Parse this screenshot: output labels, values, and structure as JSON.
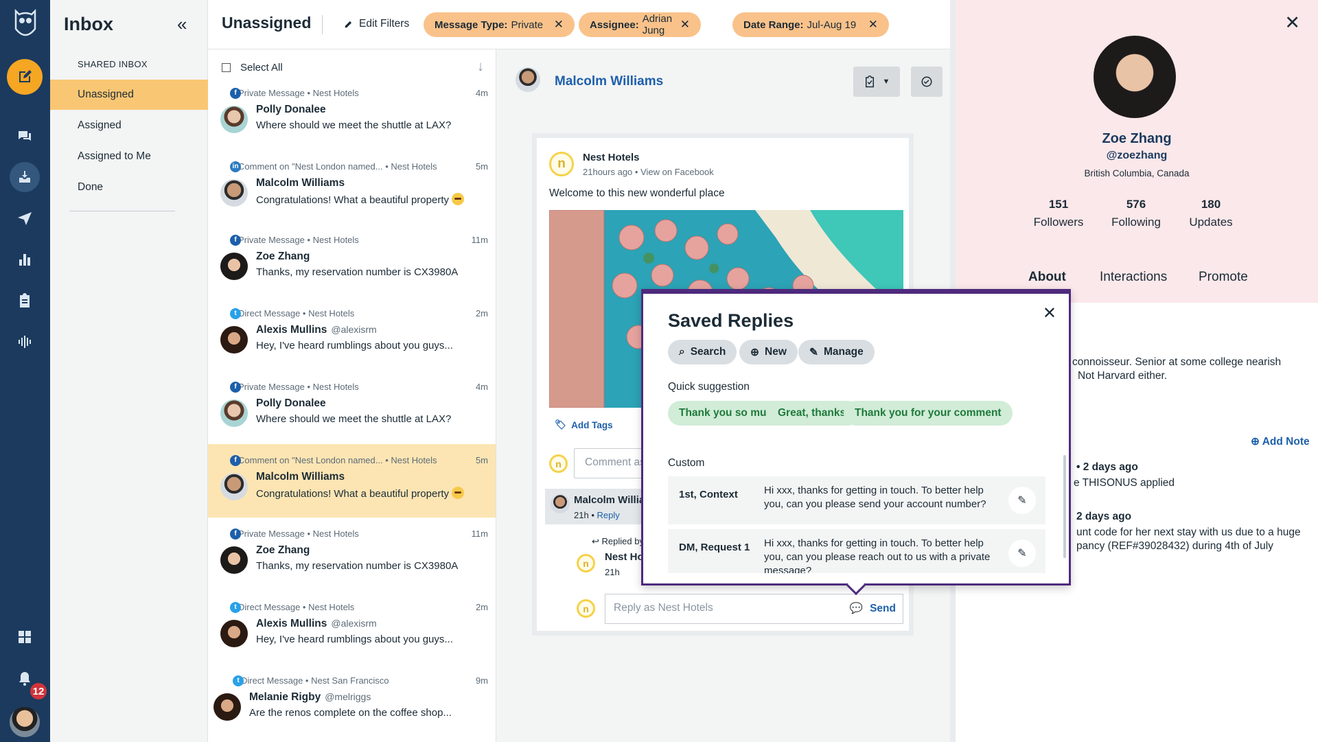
{
  "rail": {
    "notification_count": "12"
  },
  "nav": {
    "title": "Inbox",
    "section": "SHARED INBOX",
    "items": [
      "Unassigned",
      "Assigned",
      "Assigned to Me",
      "Done"
    ]
  },
  "topbar": {
    "title": "Unassigned",
    "edit_filters": "Edit Filters",
    "chips": [
      {
        "key": "Message Type:",
        "value": "Private"
      },
      {
        "key": "Assignee:",
        "value": "Adrian Jung"
      },
      {
        "key": "Date Range:",
        "value": "Jul-Aug 19"
      }
    ]
  },
  "list": {
    "select_all": "Select All",
    "messages": [
      {
        "network": "f",
        "type": "Private Message",
        "account": "Nest Hotels",
        "time": "4m",
        "name": "Polly Donalee",
        "handle": "",
        "text": "Where should we meet the shuttle at LAX?"
      },
      {
        "network": "in",
        "type": "Comment on \"Nest London named...",
        "account": "Nest Hotels",
        "time": "5m",
        "name": "Malcolm Williams",
        "handle": "",
        "text": "Congratulations! What a beautiful property"
      },
      {
        "network": "f",
        "type": "Private Message",
        "account": "Nest Hotels",
        "time": "11m",
        "name": "Zoe Zhang",
        "handle": "",
        "text": "Thanks, my reservation number is CX3980A"
      },
      {
        "network": "t",
        "type": "Direct Message",
        "account": "Nest Hotels",
        "time": "2m",
        "name": "Alexis Mullins",
        "handle": "@alexisrm",
        "text": "Hey, I've heard rumblings about you guys..."
      },
      {
        "network": "f",
        "type": "Private Message",
        "account": "Nest Hotels",
        "time": "4m",
        "name": "Polly Donalee",
        "handle": "",
        "text": "Where should we meet the shuttle at LAX?"
      },
      {
        "network": "f",
        "type": "Comment on \"Nest London named...",
        "account": "Nest Hotels",
        "time": "5m",
        "name": "Malcolm Williams",
        "handle": "",
        "text": "Congratulations! What a beautiful property"
      },
      {
        "network": "f",
        "type": "Private Message",
        "account": "Nest Hotels",
        "time": "11m",
        "name": "Zoe Zhang",
        "handle": "",
        "text": "Thanks, my reservation number is CX3980A"
      },
      {
        "network": "t",
        "type": "Direct Message",
        "account": "Nest Hotels",
        "time": "2m",
        "name": "Alexis Mullins",
        "handle": "@alexisrm",
        "text": "Hey, I've heard rumblings about you guys..."
      },
      {
        "network": "t",
        "type": "Direct Message",
        "account": "Nest San Francisco",
        "time": "9m",
        "name": "Melanie Rigby",
        "handle": "@melriggs",
        "text": "Are the renos complete on the coffee shop..."
      }
    ]
  },
  "conversation": {
    "contact": "Malcolm Williams",
    "post": {
      "brand_initial": "n",
      "account": "Nest Hotels",
      "age": "21hours ago",
      "view_on": "View on Facebook",
      "text": "Welcome to this new wonderful place"
    },
    "add_tags": "Add Tags",
    "comment_placeholder": "Comment as Nest Hotels",
    "reply_author": "Malcolm Williams",
    "reply_age": "21h",
    "reply_link": "Reply",
    "replied_by": "Replied by",
    "reply_account": "Nest Hotels",
    "reply_account_age": "21h",
    "reply_placeholder": "Reply as Nest Hotels",
    "send": "Send"
  },
  "profile": {
    "name": "Zoe Zhang",
    "handle": "@zoezhang",
    "location": "British Columbia, Canada",
    "stats": [
      {
        "value": "151",
        "label": "Followers"
      },
      {
        "value": "576",
        "label": "Following"
      },
      {
        "value": "180",
        "label": "Updates"
      }
    ],
    "tabs": [
      "About",
      "Interactions",
      "Promote"
    ],
    "bio_line1": "connoisseur. Senior at some college nearish",
    "bio_line2": "Not Harvard either.",
    "add_note": "Add Note",
    "note1_time": "2 days ago",
    "note1_text": "e THISONUS applied",
    "note2_time": "2 days ago",
    "note2_line1": "unt code for her next stay with us due to a huge",
    "note2_line2": "pancy (REF#39028432) during 4th of July"
  },
  "saved_replies": {
    "title": "Saved Replies",
    "actions": [
      "Search",
      "New",
      "Manage"
    ],
    "quick_label": "Quick suggestion",
    "suggestions": [
      "Thank you so much!",
      "Great, thanks!",
      "Thank you for your comment"
    ],
    "custom_label": "Custom",
    "custom": [
      {
        "name": "1st, Context",
        "text": "Hi xxx, thanks for getting in touch. To better help you, can you please send your account number?"
      },
      {
        "name": "DM, Request 1",
        "text": "Hi xxx, thanks for getting in touch. To better help you, can you please reach out to us with a private message?"
      }
    ]
  }
}
